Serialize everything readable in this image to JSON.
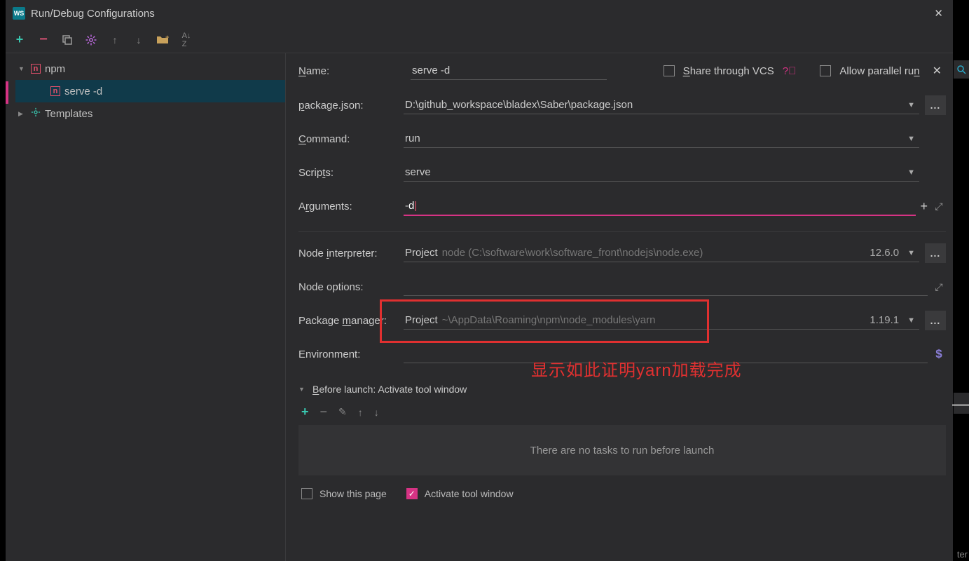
{
  "window": {
    "title": "Run/Debug Configurations"
  },
  "sidebar": {
    "items": [
      {
        "label": "npm"
      },
      {
        "label": "serve -d"
      },
      {
        "label": "Templates"
      }
    ]
  },
  "form": {
    "name_label": "Name:",
    "name_value": "serve -d",
    "share_label": "Share through VCS",
    "parallel_label": "Allow parallel run",
    "package_json_label": "package.json:",
    "package_json_value": "D:\\github_workspace\\bladex\\Saber\\package.json",
    "command_label": "Command:",
    "command_value": "run",
    "scripts_label": "Scripts:",
    "scripts_value": "serve",
    "arguments_label": "Arguments:",
    "arguments_value": "-d",
    "node_interpreter_label": "Node interpreter:",
    "node_interpreter_prefix": "Project",
    "node_interpreter_path": "node (C:\\software\\work\\software_front\\nodejs\\node.exe)",
    "node_interpreter_version": "12.6.0",
    "node_options_label": "Node options:",
    "package_manager_label": "Package manager:",
    "package_manager_prefix": "Project",
    "package_manager_path": "~\\AppData\\Roaming\\npm\\node_modules\\yarn",
    "package_manager_version": "1.19.1",
    "environment_label": "Environment:",
    "before_launch_label": "Before launch: Activate tool window",
    "tasks_placeholder": "There are no tasks to run before launch",
    "show_page_label": "Show this page",
    "activate_tool_label": "Activate tool window"
  },
  "annotation_text": "显示如此证明yarn加载完成",
  "bottom_right": "ter"
}
